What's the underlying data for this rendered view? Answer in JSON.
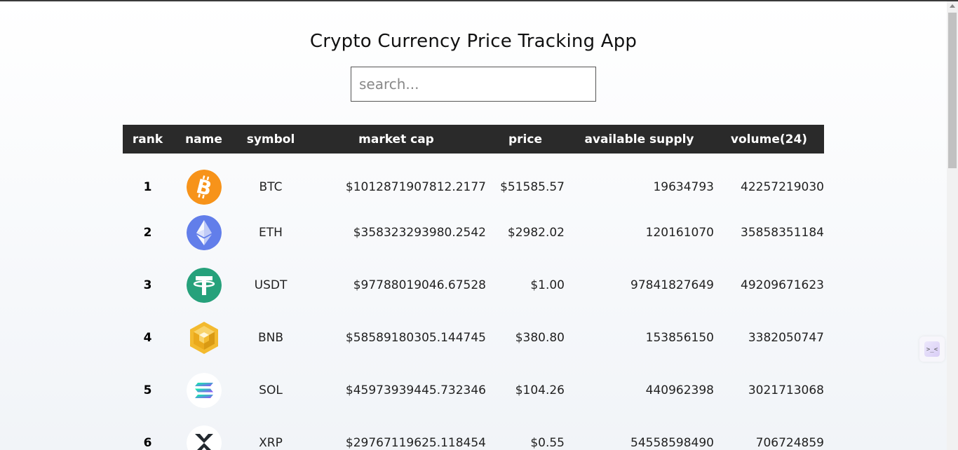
{
  "app": {
    "title": "Crypto Currency Price Tracking App"
  },
  "search": {
    "placeholder": "search..."
  },
  "table": {
    "headers": [
      "rank",
      "name",
      "symbol",
      "market cap",
      "price",
      "available supply",
      "volume(24)"
    ],
    "rows": [
      {
        "rank": "1",
        "icon": "bitcoin-icon",
        "symbol": "BTC",
        "market_cap": "$1012871907812.2177",
        "price": "$51585.57",
        "supply": "19634793",
        "volume": "42257219030"
      },
      {
        "rank": "2",
        "icon": "ethereum-icon",
        "symbol": "ETH",
        "market_cap": "$358323293980.2542",
        "price": "$2982.02",
        "supply": "120161070",
        "volume": "35858351184"
      },
      {
        "rank": "3",
        "icon": "tether-icon",
        "symbol": "USDT",
        "market_cap": "$97788019046.67528",
        "price": "$1.00",
        "supply": "97841827649",
        "volume": "49209671623"
      },
      {
        "rank": "4",
        "icon": "bnb-icon",
        "symbol": "BNB",
        "market_cap": "$58589180305.144745",
        "price": "$380.80",
        "supply": "153856150",
        "volume": "3382050747"
      },
      {
        "rank": "5",
        "icon": "solana-icon",
        "symbol": "SOL",
        "market_cap": "$45973939445.732346",
        "price": "$104.26",
        "supply": "440962398",
        "volume": "3021713068"
      },
      {
        "rank": "6",
        "icon": "xrp-icon",
        "symbol": "XRP",
        "market_cap": "$29767119625.118454",
        "price": "$0.55",
        "supply": "54558598490",
        "volume": "706724859"
      }
    ]
  },
  "colors": {
    "header_bg": "#2a2a2a",
    "bitcoin": "#f7931a",
    "ethereum": "#627eea",
    "tether": "#26a17b",
    "bnb": "#f3ba2f"
  }
}
